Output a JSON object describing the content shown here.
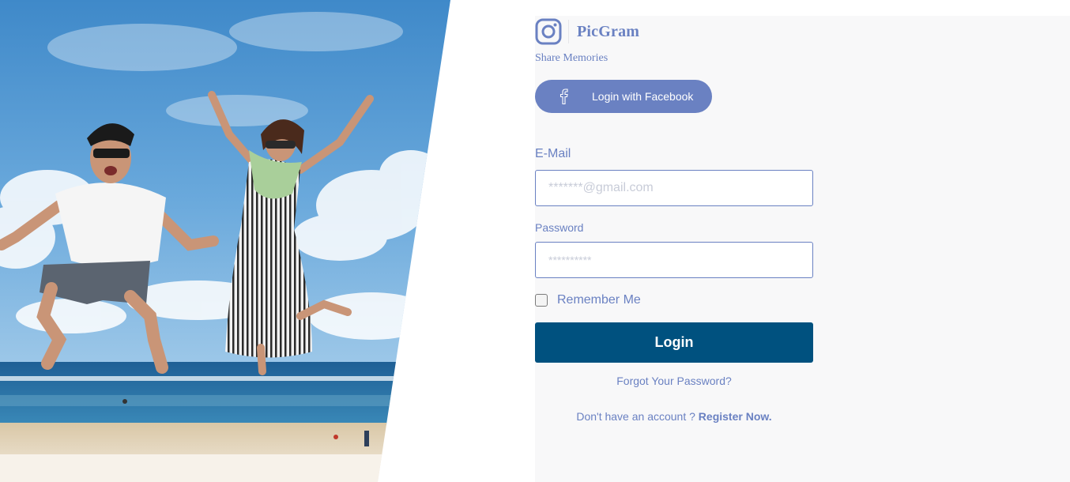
{
  "brand": {
    "name": "PicGram",
    "tagline": "Share Memories",
    "logo_icon": "instagram-camera-icon"
  },
  "facebook": {
    "label": "Login with Facebook",
    "icon": "facebook-icon"
  },
  "form": {
    "email_label": "E-Mail",
    "email_placeholder": "*******@gmail.com",
    "password_label": "Password",
    "password_placeholder": "**********",
    "remember_label": "Remember Me",
    "remember_checked": false,
    "login_label": "Login",
    "forgot_label": "Forgot Your Password?",
    "register_prompt": "Don't have an account ? ",
    "register_link": "Register Now."
  },
  "colors": {
    "accent": "#6a81c2",
    "primary_button": "#00517f",
    "panel_background": "#f8f8f9"
  },
  "hero": {
    "description_icon": "beach-photo"
  }
}
